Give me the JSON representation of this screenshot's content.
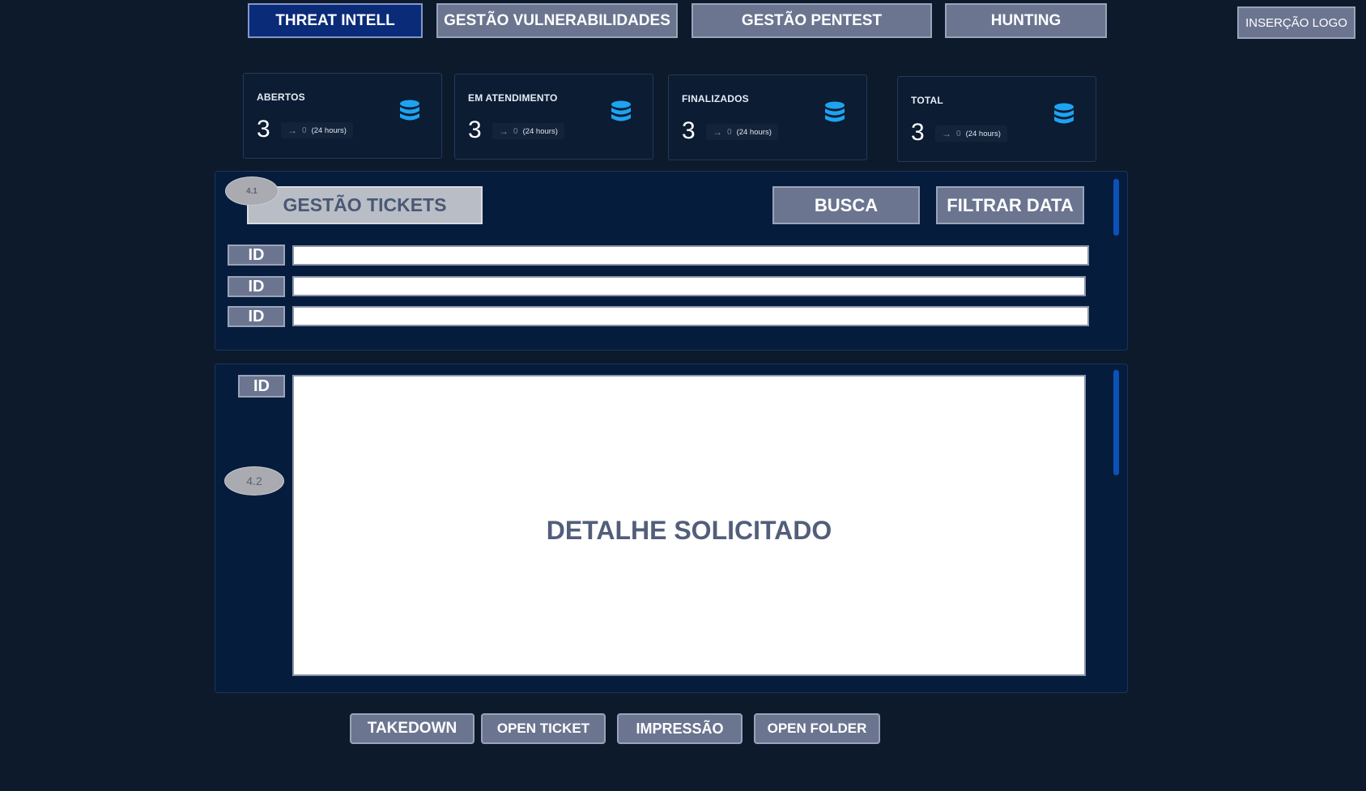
{
  "nav": {
    "tabs": [
      {
        "label": "THREAT INTELL",
        "active": true
      },
      {
        "label": "GESTÃO VULNERABILIDADES",
        "active": false
      },
      {
        "label": "GESTÃO PENTEST",
        "active": false
      },
      {
        "label": "HUNTING",
        "active": false
      }
    ],
    "logo_placeholder": "INSERÇÃO  LOGO"
  },
  "stats": [
    {
      "title": "ABERTOS",
      "value": "3",
      "delta": "0",
      "period": "(24 hours)",
      "icon": "database-icon"
    },
    {
      "title": "EM ATENDIMENTO",
      "value": "3",
      "delta": "0",
      "period": "(24 hours)",
      "icon": "database-icon"
    },
    {
      "title": "FINALIZADOS",
      "value": "3",
      "delta": "0",
      "period": "(24 hours)",
      "icon": "database-icon"
    },
    {
      "title": "TOTAL",
      "value": "3",
      "delta": "0",
      "period": "(24 hours)",
      "icon": "database-icon"
    }
  ],
  "tickets": {
    "badge": "4.1",
    "title": "GESTÃO TICKETS",
    "search_label": "BUSCA",
    "filter_label": "FILTRAR DATA",
    "rows": [
      {
        "id_label": "ID",
        "value": ""
      },
      {
        "id_label": "ID",
        "value": ""
      },
      {
        "id_label": "ID",
        "value": ""
      }
    ]
  },
  "detail": {
    "badge": "4.2",
    "id_label": "ID",
    "placeholder": "DETALHE SOLICITADO"
  },
  "actions": {
    "takedown": "TAKEDOWN",
    "open_ticket": "OPEN TICKET",
    "print": "IMPRESSÃO",
    "open_folder": "OPEN FOLDER"
  },
  "colors": {
    "background": "#0c1a2c",
    "button_gray": "#6b7590",
    "active_tab": "#0a2b78",
    "icon_blue": "#1ea3f0",
    "scroll_thumb": "#0b52b8"
  }
}
